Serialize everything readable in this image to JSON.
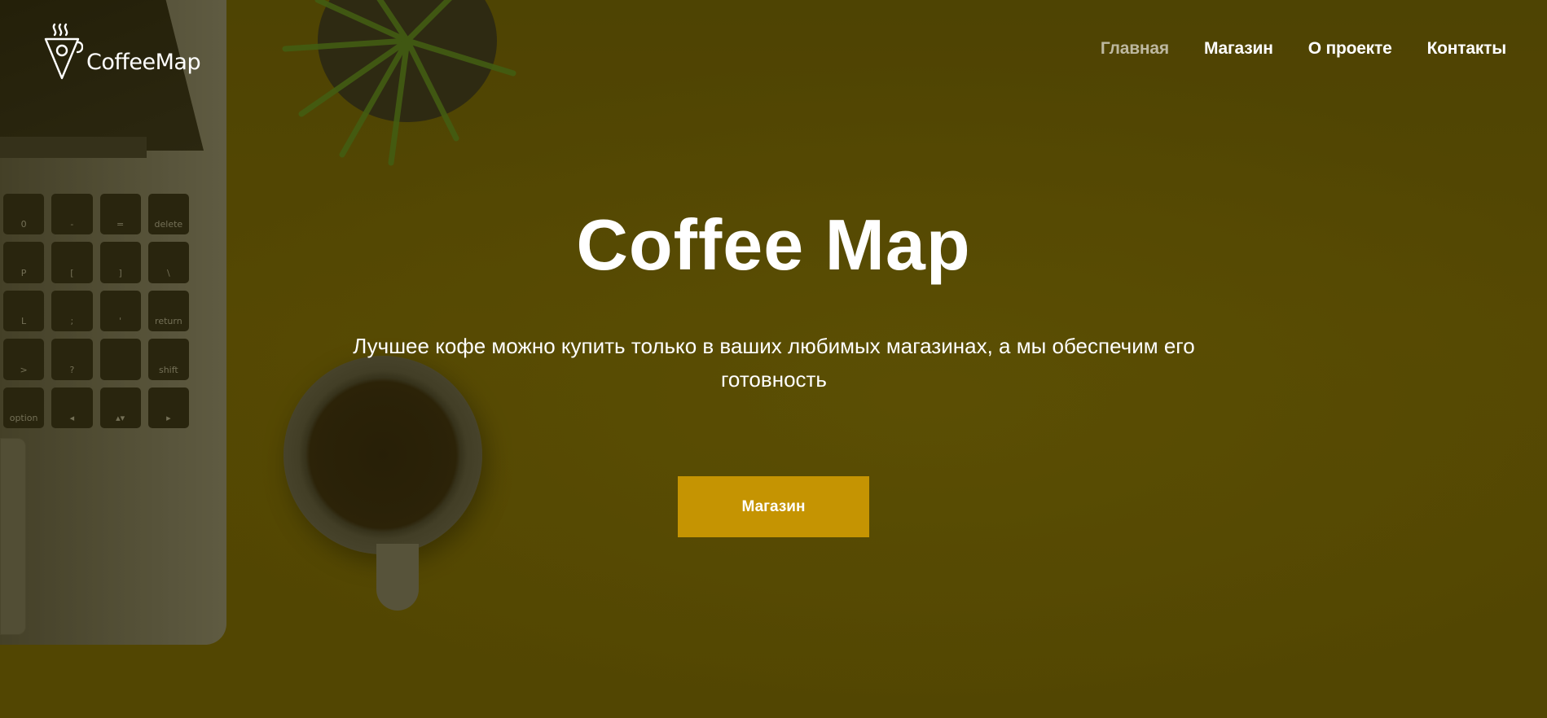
{
  "logo": {
    "text": "CoffeeMap",
    "icon": "coffee-map-pin-logo"
  },
  "nav": {
    "items": [
      {
        "label": "Главная",
        "active": true
      },
      {
        "label": "Магазин",
        "active": false
      },
      {
        "label": "О проекте",
        "active": false
      },
      {
        "label": "Контакты",
        "active": false
      }
    ],
    "active_color": "#bdb8a0",
    "color": "#ffffff"
  },
  "hero": {
    "title": "Coffee Map",
    "subtitle": "Лучшее кофе можно купить только в ваших любимых магазинах, а мы обеспечим его готовность",
    "button_label": "Магазин"
  },
  "keyboard_keys": [
    "0",
    "-",
    "=",
    "delete",
    "P",
    "[",
    "]",
    "\\",
    "L",
    ";",
    "'",
    "return",
    ">",
    "?",
    "",
    "shift",
    "option",
    "◂",
    "▴▾",
    "▸"
  ],
  "colors": {
    "accent": "#c59402",
    "background": "#514705"
  }
}
